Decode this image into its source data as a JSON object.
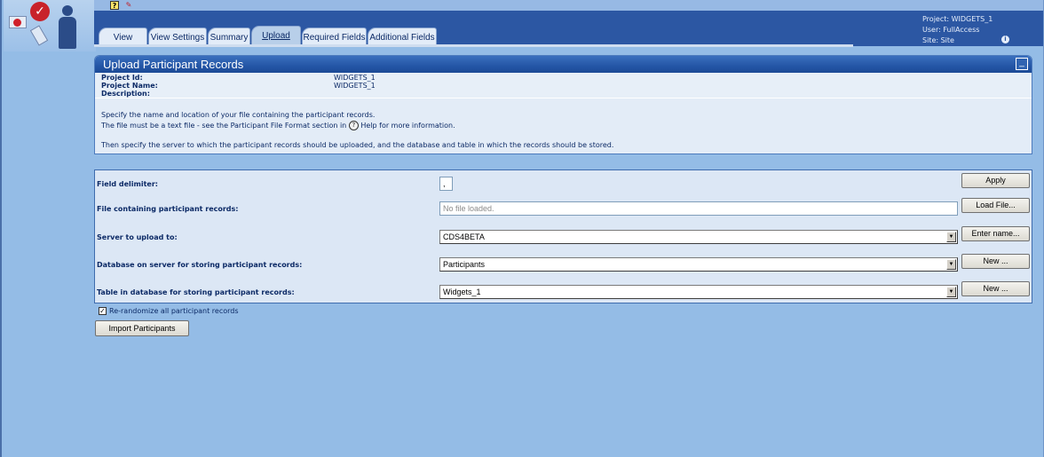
{
  "header": {
    "tabs": [
      {
        "label": "View"
      },
      {
        "label": "View Settings"
      },
      {
        "label": "Summary"
      },
      {
        "label": "Upload"
      },
      {
        "label": "Required Fields"
      },
      {
        "label": "Additional Fields"
      }
    ],
    "user_info": {
      "project": "Project: WIDGETS_1",
      "user": "User: FullAccess",
      "site": "Site: Site"
    }
  },
  "panel": {
    "title": "Upload Participant Records",
    "project_id_label": "Project Id:",
    "project_id_value": "WIDGETS_1",
    "project_name_label": "Project Name:",
    "project_name_value": "WIDGETS_1",
    "description_label": "Description:",
    "instructions": {
      "line1": "Specify the name and location of your file containing the participant records.",
      "line2a": "The file must be a text file - see the Participant File Format section in",
      "line2b": "Help for more information.",
      "line3": "Then specify the server to which the participant records should be uploaded, and the database and table in which the records should be stored."
    }
  },
  "form": {
    "delimiter": {
      "label": "Field delimiter:",
      "value": ",",
      "button": "Apply"
    },
    "file": {
      "label": "File containing participant records:",
      "placeholder": "No file loaded.",
      "button": "Load File..."
    },
    "server": {
      "label": "Server to upload to:",
      "value": "CDS4BETA",
      "button": "Enter name..."
    },
    "database": {
      "label": "Database on server for storing participant records:",
      "value": "Participants",
      "button": "New ..."
    },
    "table": {
      "label": "Table in database for storing participant records:",
      "value": "Widgets_1",
      "button": "New ..."
    }
  },
  "rerandomize_label": "Re-randomize all participant records",
  "rerandomize_checked": true,
  "import_button": "Import Participants",
  "colors": {
    "header_bg": "#2c57a3",
    "page_bg": "#94bce6",
    "panel_bg": "#e7eff8",
    "text": "#0c2a66"
  }
}
